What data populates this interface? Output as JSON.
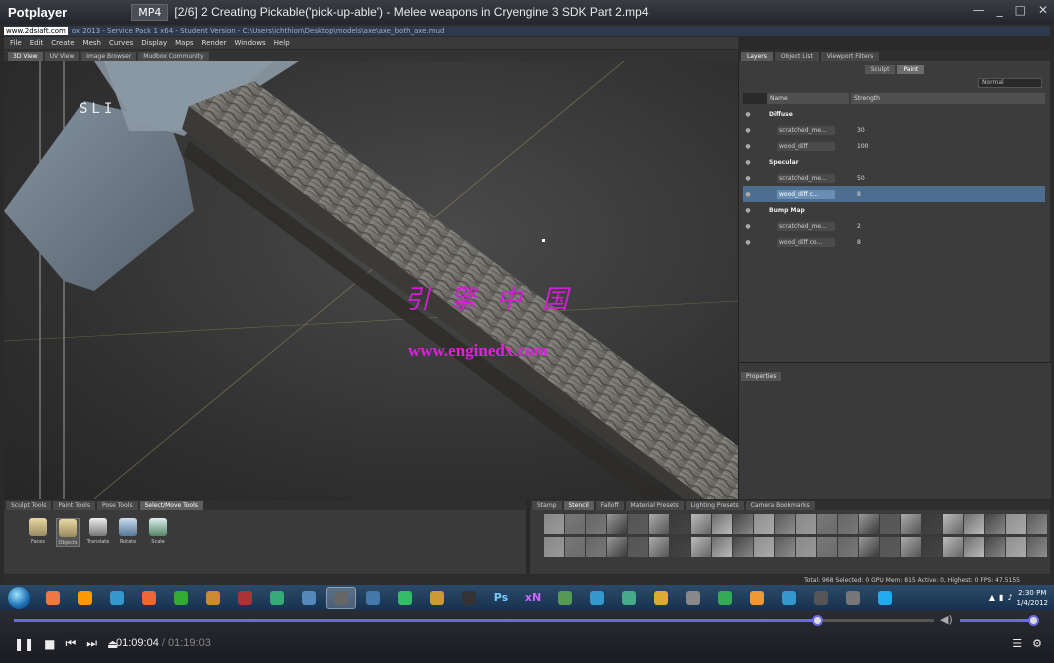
{
  "player": {
    "name": "Potplayer",
    "format": "MP4",
    "filename": "[2/6] 2 Creating Pickable('pick-up-able') - Melee weapons in Cryengine 3 SDK Part 2.mp4",
    "current_time": "01:09:04",
    "separator": " / ",
    "total_time": "01:19:03",
    "progress": 0.874,
    "volume": 0.97
  },
  "mudbox": {
    "watermark_site": "www.2dsiaft.com",
    "title_path": "ox 2013 - Service Pack 1 x64 - Student Version - C:\\Users\\ichthion\\Desktop\\models\\axe\\axe_both_axe.mud",
    "menu": [
      "File",
      "Edit",
      "Create",
      "Mesh",
      "Curves",
      "Display",
      "Maps",
      "Render",
      "Windows",
      "Help"
    ],
    "view_tabs": [
      "3D View",
      "UV View",
      "Image Browser",
      "Mudbox Community"
    ],
    "viewport_label": "SLI",
    "watermark_cn": "引擎中国",
    "watermark_url": "www.enginedx.com",
    "right_tabs": [
      "Layers",
      "Object List",
      "Viewport Filters"
    ],
    "mode_tabs": [
      "Sculpt",
      "Paint"
    ],
    "blend_mode": "Normal",
    "layer_header": {
      "name": "Name",
      "strength": "Strength"
    },
    "layers": [
      {
        "type": "group",
        "label": "Diffuse"
      },
      {
        "type": "layer",
        "label": "scratched_me...",
        "value": "30"
      },
      {
        "type": "layer",
        "label": "wood_diff",
        "value": "100"
      },
      {
        "type": "group",
        "label": "Specular"
      },
      {
        "type": "layer",
        "label": "scratched_me...",
        "value": "50"
      },
      {
        "type": "layer",
        "label": "wood_diff c...",
        "value": "8",
        "selected": true
      },
      {
        "type": "group",
        "label": "Bump Map"
      },
      {
        "type": "layer",
        "label": "scratched_me...",
        "value": "2"
      },
      {
        "type": "layer",
        "label": "wood_diff co...",
        "value": "8"
      }
    ],
    "properties_tab": "Properties",
    "tool_tabs": [
      "Sculpt Tools",
      "Paint Tools",
      "Pose Tools",
      "Select/Move Tools"
    ],
    "tools": [
      "Faces",
      "Objects",
      "Translate",
      "Rotate",
      "Scale"
    ],
    "stamp_tabs": [
      "Stamp",
      "Stencil",
      "Falloff",
      "Material Presets",
      "Lighting Presets",
      "Camera Bookmarks"
    ],
    "status": "Total: 968  Selected: 0  GPU Mem: 815  Active: 0, Highest: 0  FPS: 47.5155"
  },
  "taskbar": {
    "apps": [
      "chrome",
      "app",
      "ie",
      "firefox",
      "app",
      "app",
      "app",
      "app",
      "app",
      "mudbox",
      "app",
      "app",
      "app",
      "app",
      "Ps",
      "xN",
      "app",
      "app",
      "app",
      "app",
      "app",
      "app",
      "app",
      "app",
      "app",
      "app",
      "app"
    ],
    "time": "2:30 PM",
    "date": "1/4/2012"
  }
}
